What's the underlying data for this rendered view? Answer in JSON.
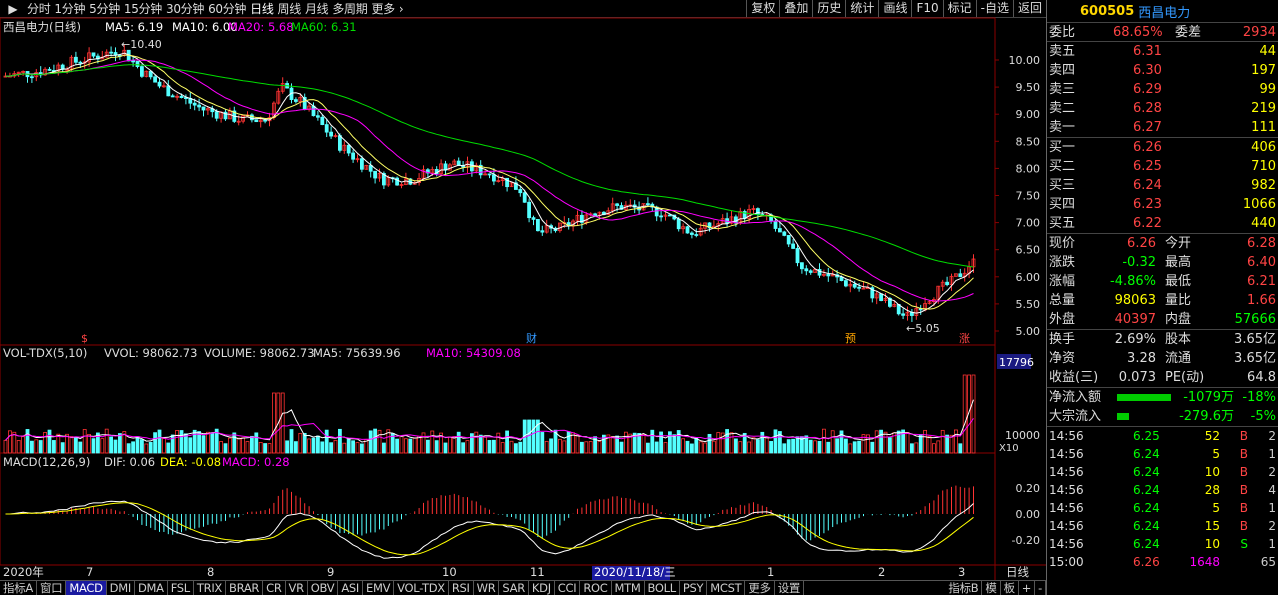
{
  "topbar": {
    "period_tabs": [
      "分时",
      "1分钟",
      "5分钟",
      "15分钟",
      "30分钟",
      "60分钟",
      "日线",
      "周线",
      "月线",
      "多周期",
      "更多"
    ],
    "more_arrow": "›",
    "buttons": [
      "复权",
      "叠加",
      "历史",
      "统计",
      "画线",
      "F10",
      "标记",
      "-自选",
      "返回"
    ]
  },
  "main": {
    "title": "西昌电力(日线)",
    "ma": [
      {
        "label": "MA5: 6.19",
        "color": "#ffffff"
      },
      {
        "label": "MA10: 6.00",
        "color": "#ffffff"
      },
      {
        "label": "MA20: 5.68",
        "color": "#ff00ff"
      },
      {
        "label": "MA60: 6.31",
        "color": "#00dd00"
      }
    ],
    "axis": [
      "10.00",
      "9.50",
      "9.00",
      "8.50",
      "8.00",
      "7.50",
      "7.00",
      "6.50",
      "6.00",
      "5.50",
      "5.00"
    ],
    "max_label": "10.40",
    "min_label": "5.05",
    "markers": [
      "$",
      "财",
      "预",
      "涨"
    ]
  },
  "volume": {
    "name": "VOL-TDX(5,10)",
    "vvol": "VVOL: 98062.73",
    "volume": "VOLUME: 98062.73",
    "ma5": "MA5: 75639.96",
    "ma10": "MA10: 54309.08",
    "axis_top": "17796",
    "axis_mid": "10000",
    "unit": "X10"
  },
  "macd": {
    "name": "MACD(12,26,9)",
    "dif": "DIF: 0.06",
    "dea": "DEA: -0.08",
    "macd": "MACD: 0.28",
    "axis": [
      "0.20",
      "0.00",
      "-0.20"
    ]
  },
  "xaxis": {
    "labels": [
      "2020年",
      "7",
      "8",
      "9",
      "10",
      "11",
      "12",
      "1",
      "2",
      "3"
    ],
    "cursor": "2020/11/18/三",
    "period": "日线"
  },
  "bottom_tabs": [
    "指标A",
    "窗口",
    "MACD",
    "DMI",
    "DMA",
    "FSL",
    "TRIX",
    "BRAR",
    "CR",
    "VR",
    "OBV",
    "ASI",
    "EMV",
    "VOL-TDX",
    "RSI",
    "WR",
    "SAR",
    "KDJ",
    "CCI",
    "ROC",
    "MTM",
    "BOLL",
    "PSY",
    "MCST",
    "更多",
    "设置"
  ],
  "bottom_right": [
    "指标B",
    "模",
    "板",
    "+",
    "-"
  ],
  "quote": {
    "code": "600505",
    "name": "西昌电力",
    "weibi_label": "委比",
    "weibi": "68.65%",
    "weicha_label": "委差",
    "weicha": "2934",
    "asks": [
      {
        "label": "卖五",
        "price": "6.31",
        "vol": "44"
      },
      {
        "label": "卖四",
        "price": "6.30",
        "vol": "197"
      },
      {
        "label": "卖三",
        "price": "6.29",
        "vol": "99"
      },
      {
        "label": "卖二",
        "price": "6.28",
        "vol": "219"
      },
      {
        "label": "卖一",
        "price": "6.27",
        "vol": "111"
      }
    ],
    "bids": [
      {
        "label": "买一",
        "price": "6.26",
        "vol": "406"
      },
      {
        "label": "买二",
        "price": "6.25",
        "vol": "710"
      },
      {
        "label": "买三",
        "price": "6.24",
        "vol": "982"
      },
      {
        "label": "买四",
        "price": "6.23",
        "vol": "1066"
      },
      {
        "label": "买五",
        "price": "6.22",
        "vol": "440"
      }
    ],
    "stats": [
      {
        "l1": "现价",
        "v1": "6.26",
        "c1": "#ff4444",
        "l2": "今开",
        "v2": "6.28",
        "c2": "#ff4444"
      },
      {
        "l1": "涨跌",
        "v1": "-0.32",
        "c1": "#00ff00",
        "l2": "最高",
        "v2": "6.40",
        "c2": "#ff4444"
      },
      {
        "l1": "涨幅",
        "v1": "-4.86%",
        "c1": "#00ff00",
        "l2": "最低",
        "v2": "6.21",
        "c2": "#ff4444"
      },
      {
        "l1": "总量",
        "v1": "98063",
        "c1": "#ffff00",
        "l2": "量比",
        "v2": "1.66",
        "c2": "#ff4444"
      },
      {
        "l1": "外盘",
        "v1": "40397",
        "c1": "#ff4444",
        "l2": "内盘",
        "v2": "57666",
        "c2": "#00ff00"
      }
    ],
    "fund": [
      {
        "l1": "换手",
        "v1": "2.69%",
        "l2": "股本",
        "v2": "3.65亿"
      },
      {
        "l1": "净资",
        "v1": "3.28",
        "l2": "流通",
        "v2": "3.65亿"
      },
      {
        "l1": "收益(三)",
        "v1": "0.073",
        "l2": "PE(动)",
        "v2": "64.8"
      }
    ],
    "flows": [
      {
        "label": "净流入额",
        "amt": "-1079万",
        "pct": "-18%"
      },
      {
        "label": "大宗流入",
        "amt": "-279.6万",
        "pct": "-5%"
      }
    ],
    "ticks": [
      {
        "t": "14:56",
        "p": "6.25",
        "v": "52",
        "d": "B",
        "n": "2"
      },
      {
        "t": "14:56",
        "p": "6.24",
        "v": "5",
        "d": "B",
        "n": "1"
      },
      {
        "t": "14:56",
        "p": "6.24",
        "v": "10",
        "d": "B",
        "n": "2"
      },
      {
        "t": "14:56",
        "p": "6.24",
        "v": "28",
        "d": "B",
        "n": "4"
      },
      {
        "t": "14:56",
        "p": "6.24",
        "v": "5",
        "d": "B",
        "n": "1"
      },
      {
        "t": "14:56",
        "p": "6.24",
        "v": "15",
        "d": "B",
        "n": "2"
      },
      {
        "t": "14:56",
        "p": "6.24",
        "v": "10",
        "d": "S",
        "n": "1"
      },
      {
        "t": "15:00",
        "p": "6.26",
        "v": "1648",
        "d": "",
        "n": "65"
      }
    ]
  }
}
